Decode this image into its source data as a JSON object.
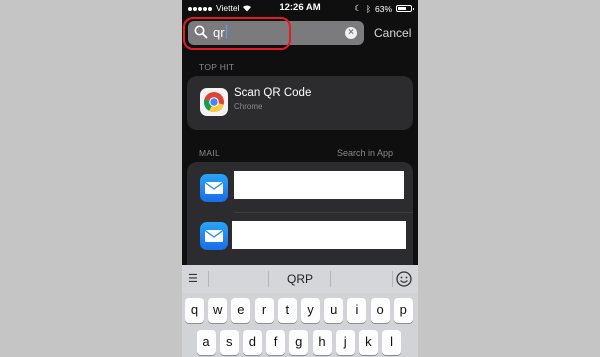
{
  "status_bar": {
    "carrier": "Viettel",
    "time": "12:26 AM",
    "battery": "63%",
    "battery_level": 0.63
  },
  "search": {
    "query": "qr",
    "cancel_label": "Cancel"
  },
  "top_hit": {
    "section_label": "TOP HIT",
    "title": "Scan QR Code",
    "subtitle": "Chrome",
    "icon": "chrome-icon"
  },
  "mail": {
    "section_label": "MAIL",
    "search_in_app_label": "Search in App",
    "icon": "mail-icon"
  },
  "keyboard": {
    "suggestion": "QRP",
    "row1": [
      "q",
      "w",
      "e",
      "r",
      "t",
      "y",
      "u",
      "i",
      "o",
      "p"
    ],
    "row2": [
      "a",
      "s",
      "d",
      "f",
      "g",
      "h",
      "j",
      "k",
      "l"
    ]
  },
  "colors": {
    "highlight": "#e41b23",
    "mail_blue": "#1a8cf0"
  }
}
